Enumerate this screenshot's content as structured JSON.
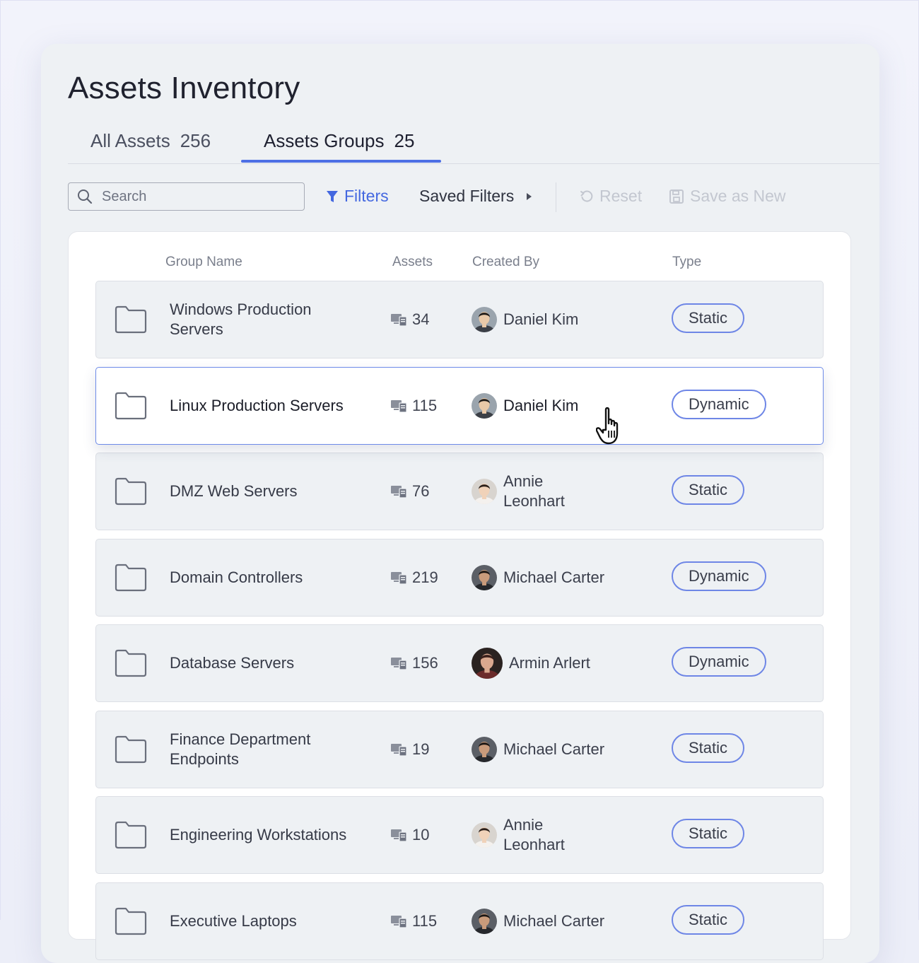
{
  "page": {
    "title": "Assets Inventory"
  },
  "tabs": [
    {
      "label": "All Assets",
      "count": "256",
      "active": false
    },
    {
      "label": "Assets Groups",
      "count": "25",
      "active": true
    }
  ],
  "toolbar": {
    "search_placeholder": "Search",
    "filters_label": "Filters",
    "saved_filters_label": "Saved Filters",
    "reset_label": "Reset",
    "save_as_new_label": "Save as New"
  },
  "table": {
    "headers": {
      "group_name": "Group Name",
      "assets": "Assets",
      "created_by": "Created By",
      "type": "Type"
    },
    "rows": [
      {
        "name": "Windows Production Servers",
        "assets": "34",
        "created_by": "Daniel Kim",
        "type": "Static",
        "selected": false
      },
      {
        "name": "Linux Production Servers",
        "assets": "115",
        "created_by": "Daniel Kim",
        "type": "Dynamic",
        "selected": true
      },
      {
        "name": "DMZ Web Servers",
        "assets": "76",
        "created_by": "Annie Leonhart",
        "type": "Static",
        "selected": false
      },
      {
        "name": "Domain Controllers",
        "assets": "219",
        "created_by": "Michael Carter",
        "type": "Dynamic",
        "selected": false
      },
      {
        "name": "Database Servers",
        "assets": "156",
        "created_by": "Armin Arlert",
        "type": "Dynamic",
        "selected": false
      },
      {
        "name": "Finance Department Endpoints",
        "assets": "19",
        "created_by": "Michael Carter",
        "type": "Static",
        "selected": false
      },
      {
        "name": "Engineering Workstations",
        "assets": "10",
        "created_by": "Annie Leonhart",
        "type": "Static",
        "selected": false
      },
      {
        "name": "Executive Laptops",
        "assets": "115",
        "created_by": "Michael Carter",
        "type": "Static",
        "selected": false
      }
    ]
  },
  "colors": {
    "accent": "#4d6fe5",
    "pill_border": "#6e86e6",
    "row_bg": "#eef1f4",
    "selected_row_border": "#6d8ae8"
  },
  "icons": {
    "search": "search-icon",
    "filter": "filter-icon",
    "caret": "caret-right-icon",
    "reset": "reset-icon",
    "save": "save-icon",
    "folder": "folder-icon",
    "assets": "devices-icon",
    "cursor": "hand-pointer-icon"
  }
}
